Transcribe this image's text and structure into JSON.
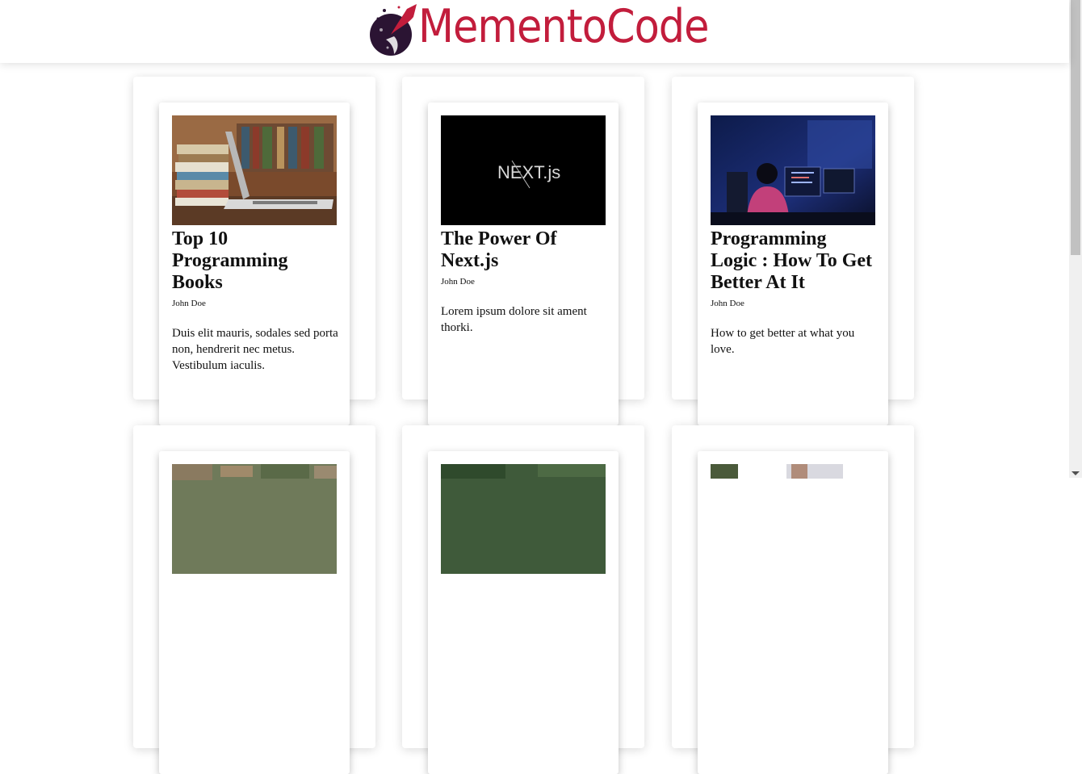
{
  "brand": {
    "name": "MementoCode",
    "color": "#c21d3c"
  },
  "posts": [
    {
      "title": "Top 10 Programming Books",
      "author": "John Doe",
      "description": "Duis elit mauris, sodales sed porta non, hendrerit nec metus. Vestibulum iaculis.",
      "image": "books-and-laptop"
    },
    {
      "title": "The Power Of Next.js",
      "author": "John Doe",
      "description": "Lorem ipsum dolore sit ament thorki.",
      "image": "nextjs-logo",
      "image_text": "NEXT.js"
    },
    {
      "title": "Programming Logic : How To Get Better At It",
      "author": "John Doe",
      "description": "How to get better at what you love.",
      "image": "programmer-at-monitors"
    },
    {
      "image": "aerial-city"
    },
    {
      "image": "green-foliage"
    },
    {
      "image": "person-outdoors"
    }
  ]
}
